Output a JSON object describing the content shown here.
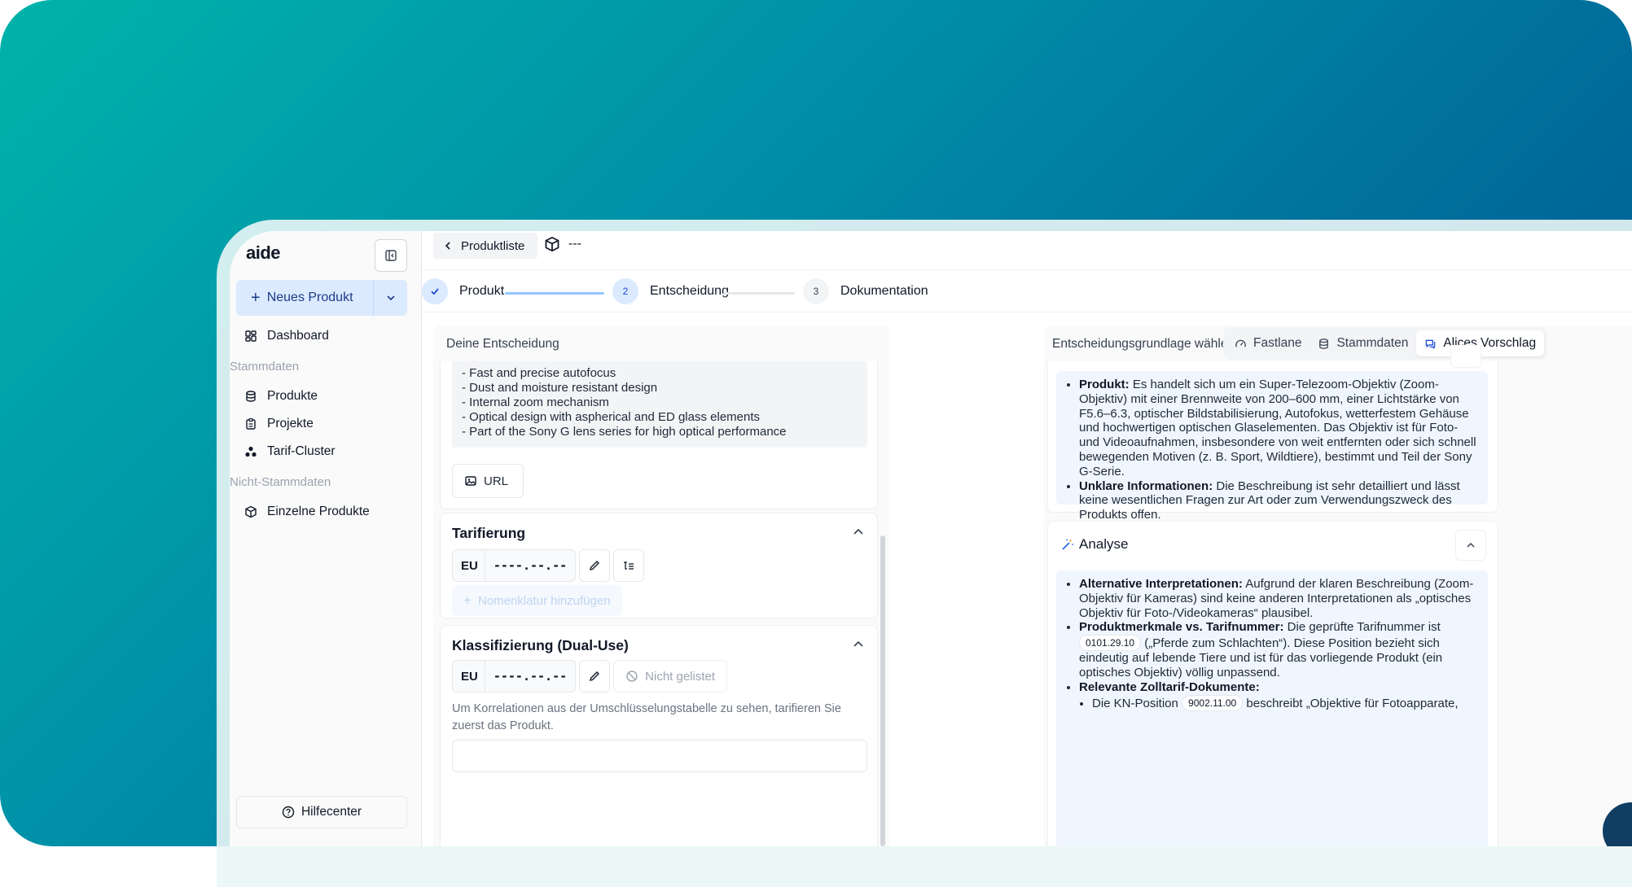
{
  "app": {
    "logo": "aide"
  },
  "sidebar": {
    "new_product_label": "Neues Produkt",
    "dashboard_label": "Dashboard",
    "section_master": "Stammdaten",
    "items_master": [
      "Produkte",
      "Projekte",
      "Tarif-Cluster"
    ],
    "section_non_master": "Nicht-Stammdaten",
    "items_non_master": [
      "Einzelne Produkte"
    ],
    "help_label": "Hilfecenter"
  },
  "topbar": {
    "back_label": "Produktliste",
    "product_name": "---"
  },
  "stepper": {
    "steps": [
      {
        "number": "",
        "label": "Produkt",
        "state": "done"
      },
      {
        "number": "2",
        "label": "Entscheidung",
        "state": "active"
      },
      {
        "number": "3",
        "label": "Dokumentation",
        "state": "todo"
      }
    ]
  },
  "decision": {
    "title": "Deine Entscheidung",
    "description_lines": [
      "- Fast and precise autofocus",
      "- Dust and moisture resistant design",
      "- Internal zoom mechanism",
      "- Optical design with aspherical and ED glass elements",
      "- Part of the Sony G lens series for high optical performance"
    ],
    "url_label": "URL",
    "tarif": {
      "heading": "Tarifierung",
      "region": "EU",
      "code_placeholder": "----.--.--",
      "add_nomenclature": "Nomenklatur hinzufügen"
    },
    "dual_use": {
      "heading": "Klassifizierung (Dual-Use)",
      "region": "EU",
      "code_placeholder": "----.--.--",
      "not_listed": "Nicht gelistet",
      "hint": "Um Korrelationen aus der Umschlüsselungstabelle zu sehen, tarifieren Sie zuerst das Produkt."
    }
  },
  "basis": {
    "title": "Entscheidungsgrundlage wählen",
    "tabs": [
      "Fastlane",
      "Stammdaten",
      "Alices Vorschlag"
    ],
    "active_tab": "Alices Vorschlag",
    "summary": {
      "product_label": "Produkt:",
      "product_text": "Es handelt sich um ein Super-Telezoom-Objektiv (Zoom-Objektiv) mit einer Brennweite von 200–600 mm, einer Lichtstärke von F5.6–6.3, optischer Bildstabilisierung, Autofokus, wetterfestem Gehäuse und hochwertigen optischen Glaselementen. Das Objektiv ist für Foto- und Videoaufnahmen, insbesondere von weit entfernten oder sich schnell bewegenden Motiven (z. B. Sport, Wildtiere), bestimmt und Teil der Sony G-Serie.",
      "unclear_label": "Unklare Informationen:",
      "unclear_text": "Die Beschreibung ist sehr detailliert und lässt keine wesentlichen Fragen zur Art oder zum Verwendungszweck des Produkts offen."
    },
    "analysis": {
      "heading": "Analyse",
      "alt_label": "Alternative Interpretationen:",
      "alt_text": "Aufgrund der klaren Beschreibung (Zoom-Objektiv für Kameras) sind keine anderen Interpretationen als „optisches Objektiv für Foto-/Videokameras“ plausibel.",
      "features_label": "Produktmerkmale vs. Tarifnummer:",
      "features_pre": "Die geprüfte Tarifnummer ist",
      "features_code": "0101.29.10",
      "features_post": "(„Pferde zum Schlachten“). Diese Position bezieht sich eindeutig auf lebende Tiere und ist für das vorliegende Produkt (ein optisches Objektiv) völlig unpassend.",
      "docs_label": "Relevante Zolltarif-Dokumente:",
      "kn_pre": "Die KN-Position",
      "kn_code": "9002.11.00",
      "kn_post": "beschreibt „Objektive für Fotoapparate,"
    }
  },
  "colors": {
    "accent": "#3b82f6",
    "accent_soft": "#dbeafe",
    "brand_gradient_start": "#00b3aa",
    "brand_gradient_end": "#00588e"
  }
}
